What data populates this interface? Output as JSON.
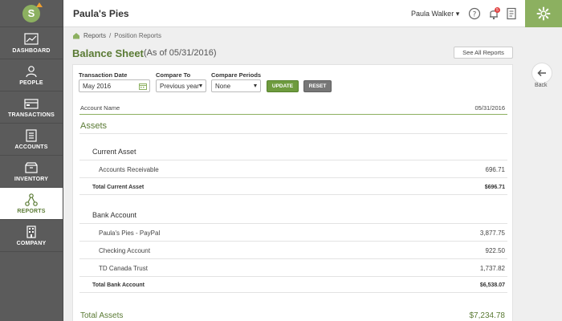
{
  "app": {
    "title": "Paula's Pies"
  },
  "user": {
    "name": "Paula Walker ▾"
  },
  "notifications": {
    "count": "5"
  },
  "sidebar": {
    "items": [
      {
        "label": "DASHBOARD",
        "icon": "chart-icon"
      },
      {
        "label": "PEOPLE",
        "icon": "people-icon"
      },
      {
        "label": "TRANSACTIONS",
        "icon": "transactions-icon"
      },
      {
        "label": "ACCOUNTS",
        "icon": "accounts-icon"
      },
      {
        "label": "INVENTORY",
        "icon": "inventory-icon"
      },
      {
        "label": "REPORTS",
        "icon": "reports-icon"
      },
      {
        "label": "COMPANY",
        "icon": "company-icon"
      }
    ]
  },
  "breadcrumb": {
    "root": "Reports",
    "sep": "/",
    "current": "Position Reports"
  },
  "page": {
    "title": "Balance Sheet",
    "subtitle": "(As of 05/31/2016)"
  },
  "buttons": {
    "see_all": "See All Reports",
    "back": "Back",
    "update": "UPDATE",
    "reset": "RESET"
  },
  "filters": {
    "transaction_date": {
      "label": "Transaction Date",
      "value": "May 2016"
    },
    "compare_to": {
      "label": "Compare To",
      "value": "Previous year"
    },
    "compare_periods": {
      "label": "Compare Periods",
      "value": "None"
    }
  },
  "table": {
    "col_name": "Account Name",
    "col_date": "05/31/2016"
  },
  "report": {
    "section": "Assets",
    "current": {
      "title": "Current Asset",
      "rows": [
        {
          "name": "Accounts Receivable",
          "value": "696.71"
        }
      ],
      "total_label": "Total Current Asset",
      "total_value": "$696.71"
    },
    "bank": {
      "title": "Bank Account",
      "rows": [
        {
          "name": "Paula's Pies - PayPal",
          "value": "3,877.75"
        },
        {
          "name": "Checking Account",
          "value": "922.50"
        },
        {
          "name": "TD Canada Trust",
          "value": "1,737.82"
        }
      ],
      "total_label": "Total Bank Account",
      "total_value": "$6,538.07"
    },
    "grand_label": "Total Assets",
    "grand_value": "$7,234.78"
  },
  "colors": {
    "accent": "#8cb060",
    "accent_dark": "#5a7a34",
    "sidebar": "#5b5b5b"
  }
}
